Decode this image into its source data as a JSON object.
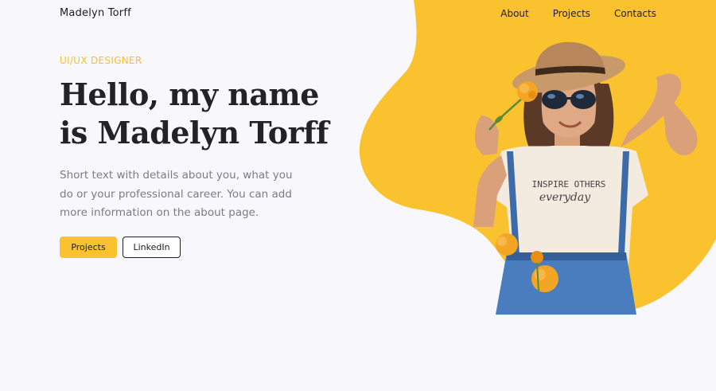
{
  "header": {
    "logo": "Madelyn Torff",
    "nav": {
      "about": "About",
      "projects": "Projects",
      "contacts": "Contacts"
    }
  },
  "hero": {
    "eyebrow": "UI/UX DESIGNER",
    "headline_line1": "Hello,  my name",
    "headline_line2": "is Madelyn Torff",
    "lead": "Short text with details about you, what you do or your professional career. You can add more information on the about page.",
    "buttons": {
      "projects": "Projects",
      "linkedin": "LinkedIn"
    },
    "shirt_text_top": "INSPIRE OTHERS",
    "shirt_text_bottom": "everyday"
  },
  "colors": {
    "accent": "#fbc230",
    "background": "#f8f8fc",
    "text": "#232326",
    "muted": "#7b7b84"
  },
  "icons": {
    "portrait": "portrait-photo"
  }
}
